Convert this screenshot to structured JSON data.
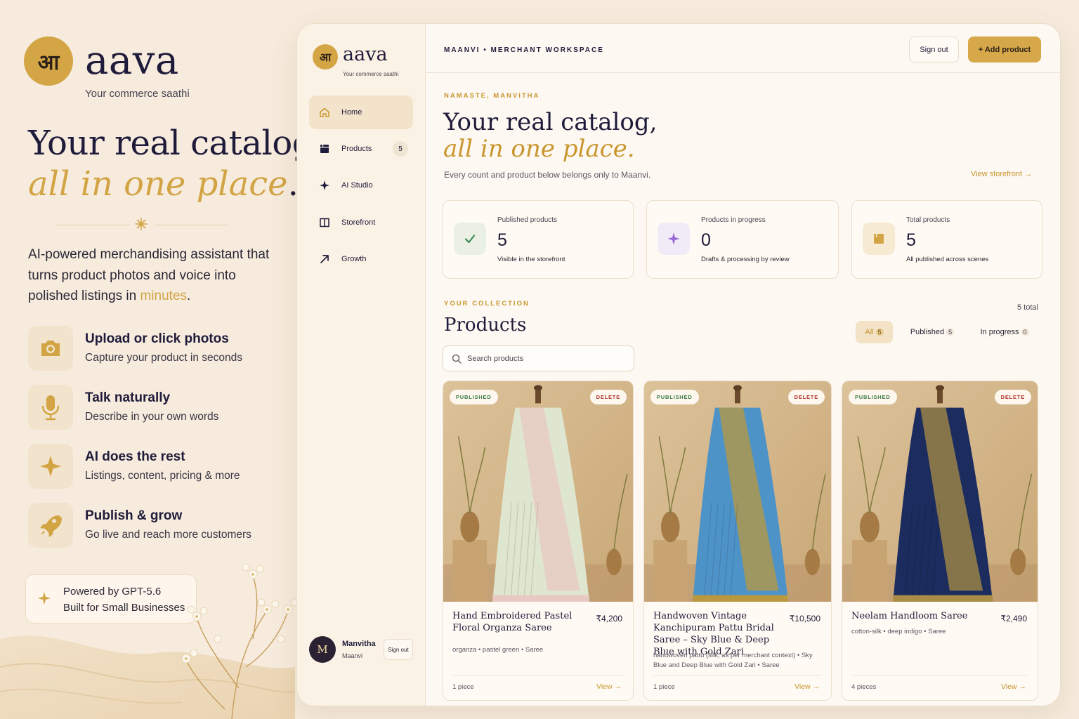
{
  "brand": {
    "badge": "आ",
    "name": "aava",
    "tagline": "Your commerce saathi"
  },
  "hero": {
    "line1": "Your real catalog,",
    "line2": "all in one place",
    "line2_end": "."
  },
  "lead": {
    "text": "AI-powered merchandising assistant that turns product photos and voice into polished listings in ",
    "highlight": "minutes",
    "end": "."
  },
  "features": [
    {
      "title": "Upload or click photos",
      "subtitle": "Capture your product in seconds",
      "icon": "camera-icon"
    },
    {
      "title": "Talk naturally",
      "subtitle": "Describe in your own words",
      "icon": "mic-icon"
    },
    {
      "title": "AI does the rest",
      "subtitle": "Listings, content, pricing & more",
      "icon": "sparkle-icon"
    },
    {
      "title": "Publish & grow",
      "subtitle": "Go live and reach more customers",
      "icon": "rocket-icon"
    }
  ],
  "powered": {
    "line1": "Powered by GPT-5.6",
    "line2": "Built for Small Businesses"
  },
  "sidebar": {
    "badge": "आ",
    "name": "aava",
    "tagline": "Your commerce saathi",
    "items": [
      {
        "label": "Home",
        "icon": "home-icon",
        "active": true
      },
      {
        "label": "Products",
        "icon": "box-icon",
        "count": "5"
      },
      {
        "label": "AI Studio",
        "icon": "sparkle-icon"
      },
      {
        "label": "Storefront",
        "icon": "storefront-icon"
      },
      {
        "label": "Growth",
        "icon": "arrow-up-right-icon"
      }
    ],
    "user": {
      "initial": "M",
      "name": "Manvitha",
      "shop": "Maanvi",
      "signout": "Sign out"
    }
  },
  "topbar": {
    "workspace": "MAANVI • MERCHANT WORKSPACE",
    "signout": "Sign out",
    "add_product": "+ Add product"
  },
  "dashboard": {
    "greeting": "NAMASTE, MANVITHA",
    "title1": "Your real catalog,",
    "title2": "all in one place.",
    "subtitle": "Every count and product below belongs only to Maanvi.",
    "view_storefront": "View storefront →"
  },
  "stats": [
    {
      "label": "Published products",
      "value": "5",
      "note": "Visible in the storefront",
      "icon": "check-icon",
      "color": "#3d8a55"
    },
    {
      "label": "Products in progress",
      "value": "0",
      "note": "Drafts & processing by review",
      "icon": "sparkle-icon",
      "color": "#9b6ad8"
    },
    {
      "label": "Total products",
      "value": "5",
      "note": "All published across scenes",
      "icon": "box-icon",
      "color": "#d2a443"
    }
  ],
  "collection": {
    "label": "YOUR COLLECTION",
    "title": "Products",
    "total": "5 total",
    "filters": [
      {
        "label": "All",
        "count": "5",
        "active": true
      },
      {
        "label": "Published",
        "count": "5"
      },
      {
        "label": "In progress",
        "count": "0"
      }
    ],
    "search_placeholder": "Search products"
  },
  "products": [
    {
      "status": "PUBLISHED",
      "delete": "DELETE",
      "title": "Hand Embroidered Pastel Floral Organza Saree",
      "price": "₹4,200",
      "tags": "organza • pastel green • Saree",
      "qty": "1 piece",
      "view": "View →",
      "saree_color": "#dfe6cf",
      "border_color": "#e8c8c3"
    },
    {
      "status": "PUBLISHED",
      "delete": "DELETE",
      "title": "Handwoven Vintage Kanchipuram Pattu Bridal Saree – Sky Blue & Deep Blue with Gold Zari",
      "price": "₹10,500",
      "tags": "handwoven pattu (silk, as per merchant context) • Sky Blue and Deep Blue with Gold Zari • Saree",
      "qty": "1 piece",
      "view": "View →",
      "saree_color": "#4e93c8",
      "border_color": "#b9983f"
    },
    {
      "status": "PUBLISHED",
      "delete": "DELETE",
      "title": "Neelam Handloom Saree",
      "price": "₹2,490",
      "tags": "cotton-silk • deep indigo • Saree",
      "qty": "4 pieces",
      "view": "View →",
      "saree_color": "#1c2c5e",
      "border_color": "#a98c45"
    }
  ]
}
